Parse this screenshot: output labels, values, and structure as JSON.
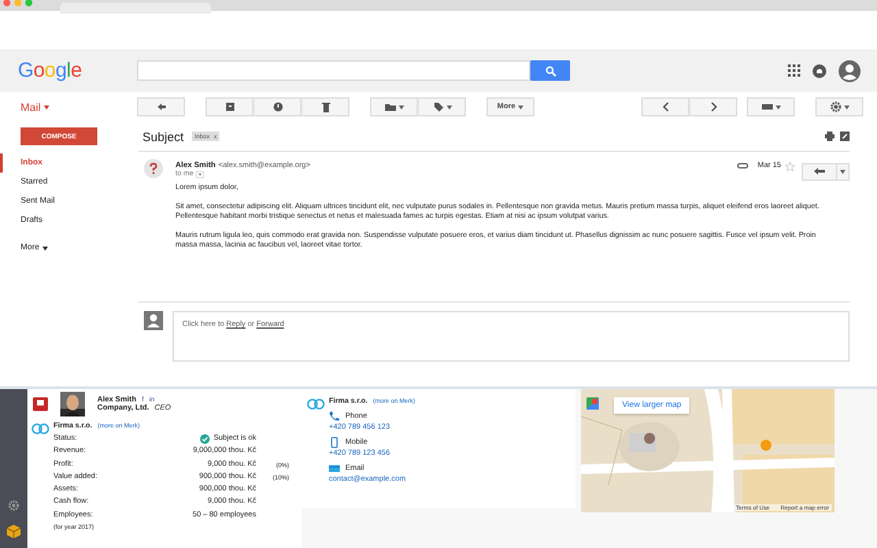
{
  "header": {
    "logo": "Google"
  },
  "app_menu": "Mail",
  "toolbar": {
    "more": "More"
  },
  "compose": "COMPOSE",
  "sidebar": {
    "items": [
      {
        "label": "Inbox",
        "selected": true
      },
      {
        "label": "Starred",
        "selected": false
      },
      {
        "label": "Sent Mail",
        "selected": false
      },
      {
        "label": "Drafts",
        "selected": false
      }
    ],
    "more": "More"
  },
  "message": {
    "subject": "Subject",
    "tag": "Inbox",
    "tag_close": "x",
    "sender": "Alex Smith",
    "address": "<alex.smith@example.org>",
    "date": "Mar 15",
    "recipient": "to me",
    "paragraphs": [
      "Lorem ipsum dolor,",
      "Sit amet, consectetur adipiscing elit. Aliquam ultrices tincidunt elit, nec vulputate purus sodales in. Pellentesque non gravida metus. Mauris pretium massa turpis, aliquet eleifend eros laoreet aliquet. Pellentesque habitant morbi tristique senectus et netus et malesuada fames ac turpis egestas. Etiam at nisi ac ipsum volutpat varius.",
      "Mauris rutrum ligula leo, quis commodo erat gravida non. Suspendisse vulputate posuere eros, et varius diam tincidunt ut. Phasellus dignissim ac nunc posuere sagittis. Fusce vel ipsum velit. Proin massa massa, lacinia ac faucibus vel, laoreet vitae tortor."
    ]
  },
  "reply_box": {
    "prefix": "Click here to ",
    "reply": "Reply",
    "middle": " or ",
    "forward": "Forward"
  },
  "merk": {
    "person": {
      "name": "Alex Smith",
      "social": [
        "f",
        "in"
      ],
      "company": "Company, Ltd.",
      "role": "CEO"
    },
    "firm": {
      "name": "Firma s.r.o.",
      "more": "(more on Merk)",
      "status_label": "Status:",
      "status": "Subject is ok",
      "rows": [
        {
          "label": "Revenue:",
          "value": "9,000,000 thou. Kč"
        },
        {
          "label": "Profit:",
          "value": "9,000 thou. Kč",
          "note": "(0%)"
        },
        {
          "label": "Value added:",
          "value": "900,000 thou. Kč",
          "note": "(10%)"
        },
        {
          "label": "Assets:",
          "value": "900,000 thou. Kč"
        },
        {
          "label": "Cash flow:",
          "value": "9,000 thou. Kč"
        },
        {
          "label": "Employees:",
          "value": "50 – 80 employees"
        }
      ],
      "footnote": "(for year 2017)"
    },
    "contact": {
      "name": "Firma s.r.o.",
      "more": "(more on Merk)",
      "items": [
        {
          "kind": "phone",
          "label": "Phone",
          "value": "+420 789 456 123"
        },
        {
          "kind": "mobile",
          "label": "Mobile",
          "value": "+420 789 123 456"
        },
        {
          "kind": "email",
          "label": "Email",
          "value": "contact@example.com"
        }
      ]
    },
    "map": {
      "button": "View larger map",
      "links": [
        "Terms of Use",
        "Report a map error"
      ]
    }
  }
}
